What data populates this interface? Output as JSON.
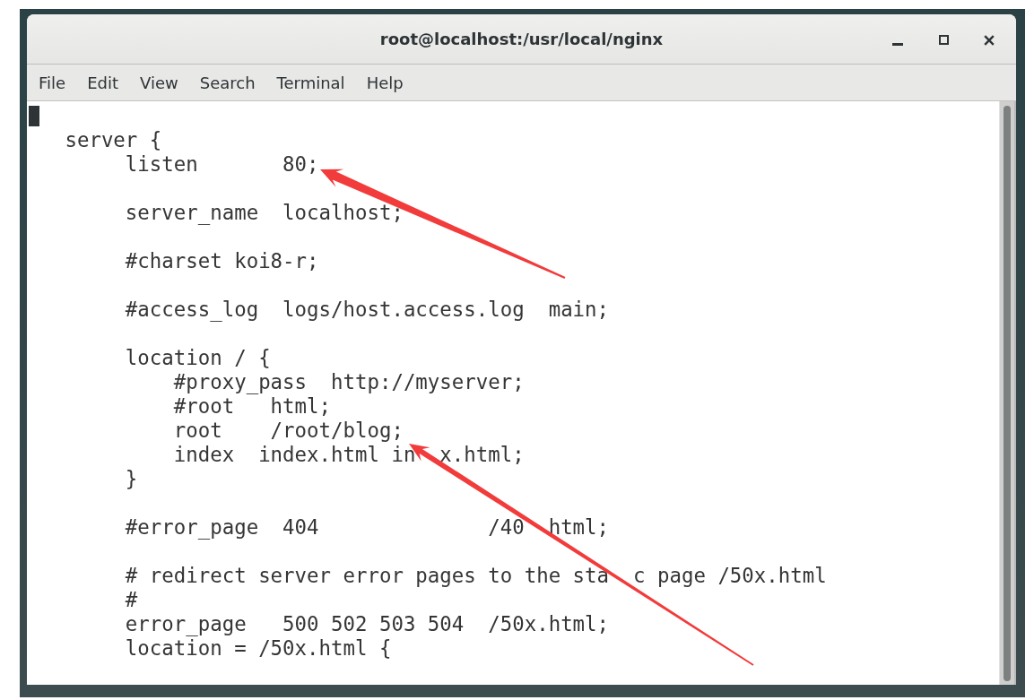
{
  "window": {
    "title": "root@localhost:/usr/local/nginx"
  },
  "menu": [
    "File",
    "Edit",
    "View",
    "Search",
    "Terminal",
    "Help"
  ],
  "terminal": {
    "cursor": true,
    "blocks": [
      [
        "   server {",
        "        listen       80;"
      ],
      [
        "        server_name  localhost;"
      ],
      [
        "        #charset koi8-r;"
      ],
      [
        "        #access_log  logs/host.access.log  main;"
      ],
      [
        "        location / {",
        "            #proxy_pass  http://myserver;",
        "            #root   html;",
        "            root    /root/blog;",
        "            index  index.html in  x.html;",
        "        }"
      ],
      [
        "        #error_page  404              /40  html;"
      ],
      [
        "        # redirect server error pages to the sta  c page /50x.html",
        "        #",
        "        error_page   500 502 503 504  /50x.html;",
        "        location = /50x.html {"
      ]
    ]
  },
  "annotations": [
    {
      "kind": "arrow"
    },
    {
      "kind": "arrow"
    }
  ]
}
